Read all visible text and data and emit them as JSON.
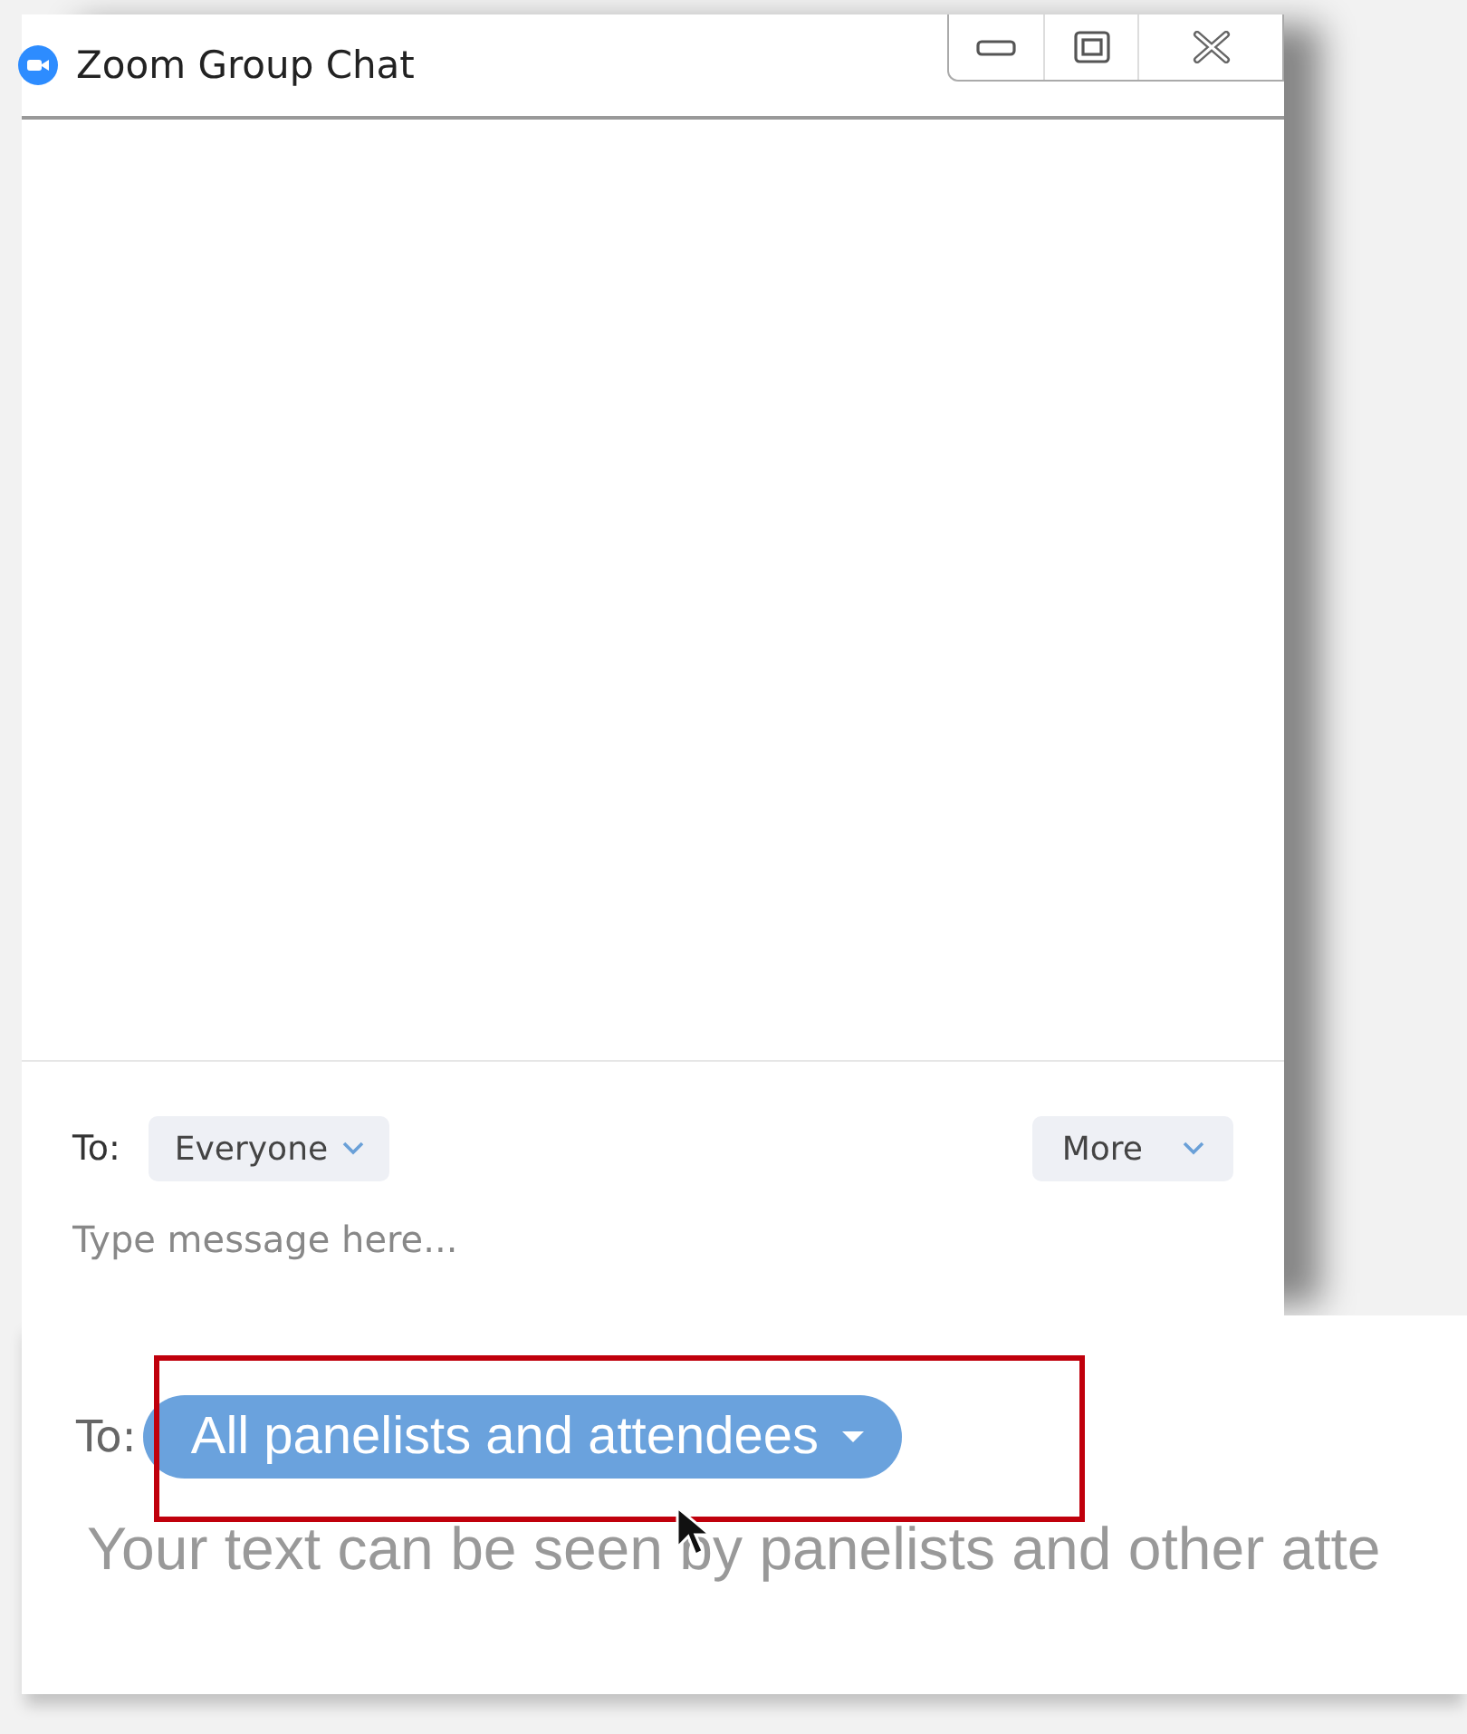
{
  "window": {
    "title": "Zoom Group Chat"
  },
  "compose": {
    "to_label": "To:",
    "recipient": "Everyone",
    "more": "More",
    "placeholder": "Type message here..."
  },
  "inset": {
    "to_label": "To:",
    "recipient": "All panelists and attendees",
    "placeholder": "Your text can be seen by panelists and other atte"
  }
}
